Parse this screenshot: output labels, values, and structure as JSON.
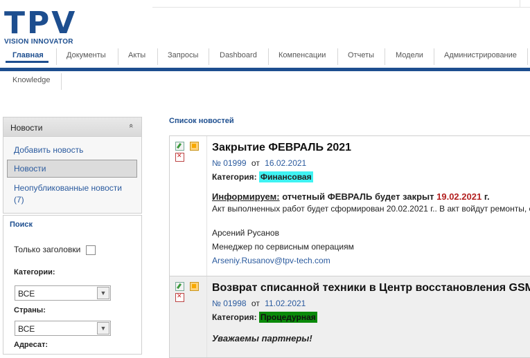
{
  "logo": {
    "main": "TPV",
    "sub": "VISION INNOVATOR"
  },
  "nav": {
    "items": [
      {
        "label": "Главная",
        "active": true
      },
      {
        "label": "Документы"
      },
      {
        "label": "Акты"
      },
      {
        "label": "Запросы"
      },
      {
        "label": "Dashboard"
      },
      {
        "label": "Компенсации"
      },
      {
        "label": "Отчеты"
      },
      {
        "label": "Модели"
      },
      {
        "label": "Администрирование"
      }
    ],
    "sub_items": [
      {
        "label": "Knowledge"
      }
    ]
  },
  "news_panel": {
    "title": "Новости",
    "collapse_icon": "«",
    "links": [
      {
        "label": "Добавить новость"
      },
      {
        "label": "Новости",
        "selected": true
      },
      {
        "label": "Неопубликованные новости (7)"
      }
    ]
  },
  "search": {
    "title": "Поиск",
    "headlines_only_label": "Только заголовки",
    "categories_label": "Категории:",
    "categories_value": "ВСЕ",
    "countries_label": "Страны:",
    "countries_value": "ВСЕ",
    "recipient_label": "Адресат:"
  },
  "news": {
    "header": "Список новостей",
    "items": [
      {
        "title": "Закрытие ФЕВРАЛЬ 2021",
        "number": "№ 01999",
        "from": "от",
        "date": "16.02.2021",
        "category_label": "Категория:",
        "category": "Финансовая",
        "category_color": "#3ff3f3",
        "inform_label": "Информируем:",
        "inform_text_before": "отчетный ФЕВРАЛЬ будет закрыт",
        "inform_date": "19.02.2021",
        "inform_suffix": "г.",
        "act_text": "Акт выполненных работ будет сформирован 20.02.2021 г.. В акт войдут ремонты, с",
        "signature_name": "Арсений Русанов",
        "signature_role": "Менеджер по сервисным операциям",
        "signature_email": "Arseniy.Rusanov@tpv-tech.com"
      },
      {
        "title": "Возврат списанной техники в Центр восстановления GSM",
        "number": "№ 01998",
        "from": "от",
        "date": "11.02.2021",
        "category_label": "Категория:",
        "category": "Процедурная",
        "category_color": "#0a8a0a",
        "greeting": "Уважаемы партнеры!"
      }
    ]
  },
  "colors": {
    "brand": "#1d4e8f"
  },
  "icons": [
    "edit-icon",
    "new-icon",
    "delete-icon",
    "collapse-icon",
    "chevron-down-icon"
  ]
}
